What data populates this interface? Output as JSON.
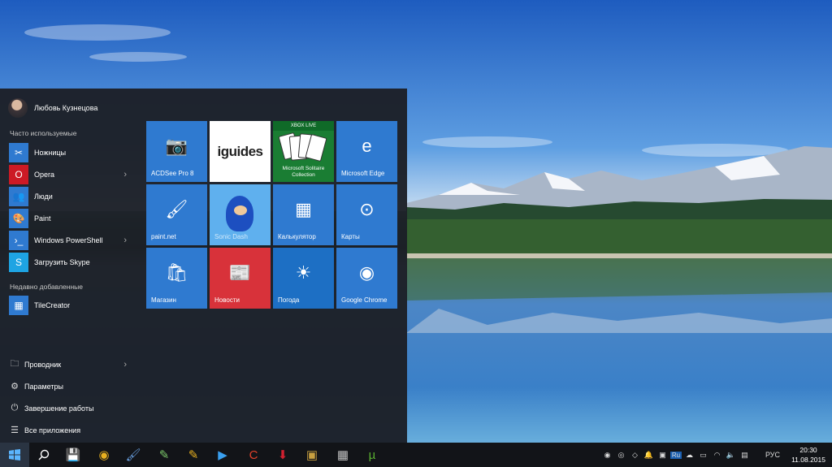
{
  "start_menu": {
    "user_name": "Любовь Кузнецова",
    "frequent_header": "Часто используемые",
    "frequent_apps": [
      {
        "label": "Ножницы",
        "icon": "scissors-icon",
        "color": "#2f7ad0",
        "glyph": "✂",
        "has_submenu": false
      },
      {
        "label": "Opera",
        "icon": "opera-icon",
        "color": "#cc1a25",
        "glyph": "O",
        "has_submenu": true
      },
      {
        "label": "Люди",
        "icon": "people-icon",
        "color": "#2f7ad0",
        "glyph": "👥",
        "has_submenu": false
      },
      {
        "label": "Paint",
        "icon": "paint-icon",
        "color": "#2f7ad0",
        "glyph": "🎨",
        "has_submenu": false
      },
      {
        "label": "Windows PowerShell",
        "icon": "powershell-icon",
        "color": "#2f7ad0",
        "glyph": "›_",
        "has_submenu": true
      },
      {
        "label": "Загрузить Skype",
        "icon": "skype-icon",
        "color": "#1ea4e3",
        "glyph": "S",
        "has_submenu": false
      }
    ],
    "recent_header": "Недавно добавленные",
    "recent_apps": [
      {
        "label": "TileCreator",
        "icon": "tilecreator-icon",
        "color": "#2f7ad0",
        "glyph": "▦"
      }
    ],
    "system_items": [
      {
        "label": "Проводник",
        "icon": "file-explorer-icon",
        "glyph": "🗀",
        "has_submenu": true
      },
      {
        "label": "Параметры",
        "icon": "gear-icon",
        "glyph": "⚙",
        "has_submenu": false
      },
      {
        "label": "Завершение работы",
        "icon": "power-icon",
        "glyph": "⏻",
        "has_submenu": false
      },
      {
        "label": "Все приложения",
        "icon": "list-icon",
        "glyph": "☰",
        "has_submenu": false
      }
    ],
    "tiles": [
      {
        "label": "ACDSee Pro 8",
        "icon": "acdsee-icon",
        "glyph": "📷",
        "color": "#2f7ad0"
      },
      {
        "label": "",
        "icon": "iguides-logo",
        "text": "iguides",
        "color": "#ffffff"
      },
      {
        "label": "Microsoft Solitaire Collection",
        "icon": "solitaire-icon",
        "badge": "XBOX LIVE",
        "color": "#1a7d33"
      },
      {
        "label": "Microsoft Edge",
        "icon": "edge-icon",
        "glyph": "e",
        "color": "#2f7ad0"
      },
      {
        "label": "paint.net",
        "icon": "paintnet-icon",
        "glyph": "🖌",
        "color": "#2f7ad0"
      },
      {
        "label": "Sonic Dash",
        "icon": "sonic-dash-icon",
        "glyph": "",
        "color": "#5fb0ee"
      },
      {
        "label": "Калькулятор",
        "icon": "calculator-icon",
        "glyph": "▦",
        "color": "#2f7ad0"
      },
      {
        "label": "Карты",
        "icon": "maps-icon",
        "glyph": "⊙",
        "color": "#2f7ad0"
      },
      {
        "label": "Магазин",
        "icon": "store-icon",
        "glyph": "🛍",
        "color": "#2f7ad0"
      },
      {
        "label": "Новости",
        "icon": "news-icon",
        "glyph": "📰",
        "color": "#d8323a"
      },
      {
        "label": "Погода",
        "icon": "weather-icon",
        "glyph": "☀",
        "color": "#1d6fc4"
      },
      {
        "label": "Google Chrome",
        "icon": "chrome-icon",
        "glyph": "◉",
        "color": "#2f7ad0"
      }
    ]
  },
  "taskbar": {
    "start_icon": "windows-logo-icon",
    "search_icon": "search-icon",
    "pinned": [
      {
        "icon": "save-disk-icon",
        "glyph": "💾",
        "color": "#3a78c8"
      },
      {
        "icon": "chrome-icon",
        "glyph": "◉",
        "color": "#e8b020"
      },
      {
        "icon": "paintnet-icon",
        "glyph": "🖌",
        "color": "#6aa0e0"
      },
      {
        "icon": "notepad-icon",
        "glyph": "✎",
        "color": "#7cc86a"
      },
      {
        "icon": "pencil-icon",
        "glyph": "✎",
        "color": "#e8b020"
      },
      {
        "icon": "play-icon",
        "glyph": "▶",
        "color": "#3aa0f0"
      },
      {
        "icon": "ccleaner-icon",
        "glyph": "C",
        "color": "#e0402a"
      },
      {
        "icon": "downloader-icon",
        "glyph": "⬇",
        "color": "#d02030"
      },
      {
        "icon": "monitor-icon",
        "glyph": "▣",
        "color": "#c8a040"
      },
      {
        "icon": "calculator-icon",
        "glyph": "▦",
        "color": "#c0c0c0"
      },
      {
        "icon": "utorrent-icon",
        "glyph": "µ",
        "color": "#5ab030"
      }
    ],
    "tray_icons": [
      "opera-tray-icon",
      "chrome-tray-icon",
      "dropbox-icon",
      "notification-bell-icon",
      "display-icon",
      "ru-badge-icon",
      "cloud-icon",
      "battery-icon",
      "wifi-icon",
      "volume-icon",
      "message-icon"
    ],
    "tray_ru_label": "Ru",
    "language": "РУС",
    "time": "20:30",
    "date": "11.08.2015"
  }
}
